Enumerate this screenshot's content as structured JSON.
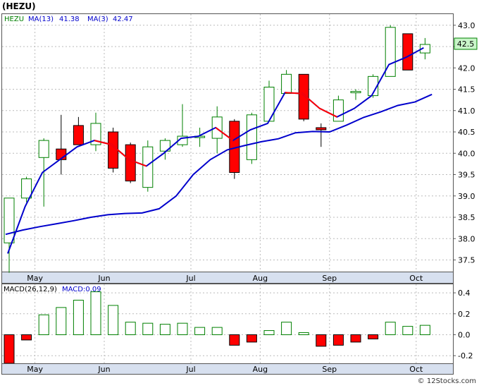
{
  "ticker_title": "(HEZU)",
  "legend": {
    "main": [
      {
        "text": "HEZU",
        "color": "#008000"
      },
      {
        "text": "MA(13)",
        "color": "#0000cc"
      },
      {
        "text": "41.38",
        "color": "#0000cc"
      },
      {
        "text": "MA(3)",
        "color": "#0000cc"
      },
      {
        "text": "42.47",
        "color": "#0000cc"
      }
    ],
    "macd": [
      {
        "text": "MACD(26,12,9)",
        "color": "#000000"
      },
      {
        "text": "MACD:0.09",
        "color": "#0000cc"
      }
    ]
  },
  "watermark": "© 12Stocks.com",
  "last_price_label": "42.5",
  "colors": {
    "up": "#008000",
    "down": "#ff0000",
    "ma_line": "#0000cc",
    "ma3_down_segment": "#ff0000",
    "axis_band": "#d7e0ef",
    "grid": "#bbbbbb",
    "price_tag_bg": "#c9f5c9"
  },
  "chart_data": [
    {
      "type": "candlestick",
      "title": "(HEZU)",
      "ylim": [
        37.2,
        43.2
      ],
      "y_ticks": [
        "37.5",
        "38.0",
        "38.5",
        "39.0",
        "39.5",
        "40.0",
        "40.5",
        "41.0",
        "41.5",
        "42.0",
        "42.5",
        "43.0"
      ],
      "x_month_labels": [
        "May",
        "Jun",
        "Jul",
        "Aug",
        "Sep",
        "Oct"
      ],
      "month_label_after_index": [
        1,
        5,
        10,
        14,
        18,
        23
      ],
      "grid": true,
      "candles": [
        {
          "o": 37.9,
          "h": 38.9,
          "l": 37.2,
          "c": 38.95
        },
        {
          "o": 38.95,
          "h": 39.45,
          "l": 38.85,
          "c": 39.4
        },
        {
          "o": 39.9,
          "h": 40.35,
          "l": 38.75,
          "c": 40.3
        },
        {
          "o": 40.1,
          "h": 40.9,
          "l": 39.5,
          "c": 39.85
        },
        {
          "o": 40.65,
          "h": 40.85,
          "l": 40.2,
          "c": 40.2
        },
        {
          "o": 40.2,
          "h": 40.95,
          "l": 40.05,
          "c": 40.7
        },
        {
          "o": 40.5,
          "h": 40.6,
          "l": 39.55,
          "c": 39.65
        },
        {
          "o": 40.2,
          "h": 40.25,
          "l": 39.3,
          "c": 39.35
        },
        {
          "o": 39.2,
          "h": 40.3,
          "l": 39.1,
          "c": 40.15
        },
        {
          "o": 40.05,
          "h": 40.35,
          "l": 39.85,
          "c": 40.3
        },
        {
          "o": 40.2,
          "h": 41.15,
          "l": 40.15,
          "c": 40.4
        },
        {
          "o": 40.4,
          "h": 40.6,
          "l": 40.15,
          "c": 40.4
        },
        {
          "o": 40.35,
          "h": 41.1,
          "l": 40.0,
          "c": 40.85
        },
        {
          "o": 40.75,
          "h": 40.8,
          "l": 39.4,
          "c": 39.55
        },
        {
          "o": 39.85,
          "h": 40.95,
          "l": 39.75,
          "c": 40.9
        },
        {
          "o": 40.75,
          "h": 41.7,
          "l": 40.75,
          "c": 41.55
        },
        {
          "o": 41.4,
          "h": 41.95,
          "l": 41.4,
          "c": 41.85
        },
        {
          "o": 41.85,
          "h": 41.85,
          "l": 40.75,
          "c": 40.8
        },
        {
          "o": 40.6,
          "h": 40.7,
          "l": 40.15,
          "c": 40.55
        },
        {
          "o": 40.75,
          "h": 41.35,
          "l": 40.75,
          "c": 41.25
        },
        {
          "o": 41.45,
          "h": 41.5,
          "l": 41.25,
          "c": 41.45
        },
        {
          "o": 41.35,
          "h": 41.85,
          "l": 41.3,
          "c": 41.8
        },
        {
          "o": 41.8,
          "h": 43.0,
          "l": 41.8,
          "c": 42.95
        },
        {
          "o": 42.8,
          "h": 42.8,
          "l": 41.95,
          "c": 41.95
        },
        {
          "o": 42.35,
          "h": 42.7,
          "l": 42.2,
          "c": 42.55
        }
      ],
      "ma13": [
        38.1,
        38.2,
        38.28,
        38.35,
        38.42,
        38.5,
        38.56,
        38.59,
        38.6,
        38.7,
        39.0,
        39.5,
        39.85,
        40.08,
        40.18,
        40.27,
        40.34,
        40.48,
        40.51,
        40.5,
        40.66,
        40.84,
        40.97,
        41.12,
        41.2,
        41.38
      ],
      "ma3": [
        37.65,
        38.75,
        39.55,
        39.85,
        40.15,
        40.3,
        40.2,
        39.85,
        39.7,
        40.0,
        40.35,
        40.4,
        40.6,
        40.3,
        40.55,
        40.7,
        41.42,
        41.4,
        41.05,
        40.85,
        41.05,
        41.35,
        42.08,
        42.25,
        42.47
      ],
      "ma3_red_segments": [
        [
          5,
          8
        ],
        [
          12,
          13
        ],
        [
          16,
          19
        ]
      ]
    },
    {
      "type": "bar",
      "title": "MACD(26,12,9)",
      "ylim": [
        -0.32,
        0.48
      ],
      "y_ticks": [
        "-0.2",
        "0.0",
        "0.2",
        "0.4"
      ],
      "values": [
        -0.28,
        -0.05,
        0.19,
        0.26,
        0.33,
        0.41,
        0.28,
        0.12,
        0.11,
        0.1,
        0.11,
        0.07,
        0.07,
        -0.1,
        -0.07,
        0.04,
        0.12,
        0.02,
        -0.11,
        -0.1,
        -0.07,
        -0.04,
        0.12,
        0.08,
        0.09
      ],
      "series": [
        {
          "name": "MACD:0.09",
          "values": [
            -0.28,
            -0.05,
            0.19,
            0.26,
            0.33,
            0.41,
            0.28,
            0.12,
            0.11,
            0.1,
            0.11,
            0.07,
            0.07,
            -0.1,
            -0.07,
            0.04,
            0.12,
            0.02,
            -0.11,
            -0.1,
            -0.07,
            -0.04,
            0.12,
            0.08,
            0.09
          ]
        }
      ]
    }
  ]
}
